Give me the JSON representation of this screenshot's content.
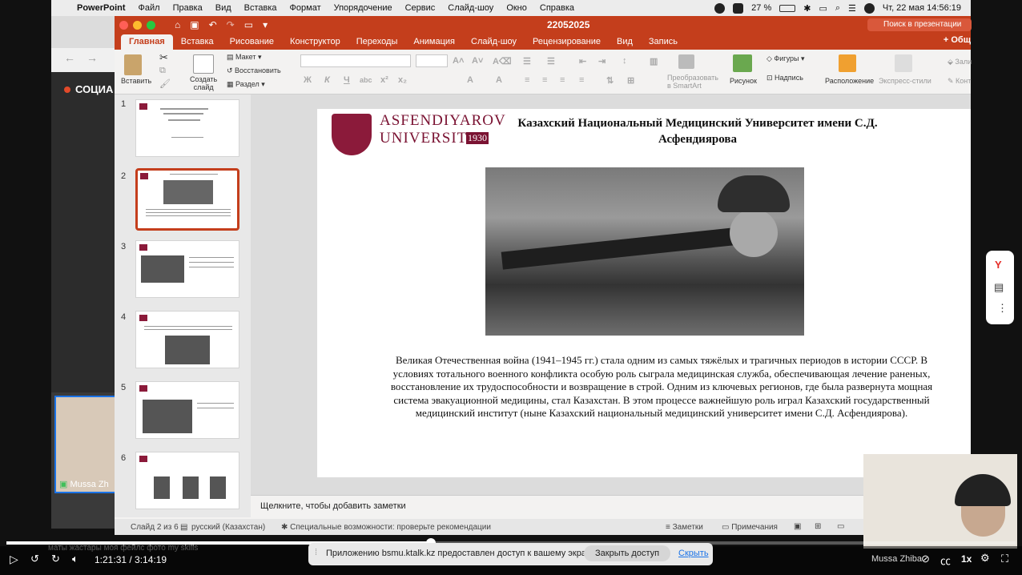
{
  "menubar": {
    "app": "PowerPoint",
    "items": [
      "Файл",
      "Правка",
      "Вид",
      "Вставка",
      "Формат",
      "Упорядочение",
      "Сервис",
      "Слайд-шоу",
      "Окно",
      "Справка"
    ],
    "battery": "27 %",
    "datetime": "Чт, 22 мая  14:56:19"
  },
  "background": {
    "social_label": "СОЦИА",
    "self_cam_name": "Mussa Zh"
  },
  "ppt": {
    "doc_title": "22052025",
    "search_placeholder": "Поиск в презентации",
    "share_label": "Общ",
    "tabs": [
      "Главная",
      "Вставка",
      "Рисование",
      "Конструктор",
      "Переходы",
      "Анимация",
      "Слайд-шоу",
      "Рецензирование",
      "Вид",
      "Запись"
    ],
    "ribbon": {
      "paste": "Вставить",
      "new_slide": "Создать\nслайд",
      "layout": "Макет",
      "reset": "Восстановить",
      "section": "Раздел",
      "convert_smartart": "Преобразовать\nв SmartArt",
      "picture": "Рисунок",
      "shapes": "Фигуры",
      "textbox": "Надпись",
      "arrange": "Расположение",
      "quick_styles": "Экспресс-стили",
      "fill_short": "Зали",
      "outline_short": "Конт"
    },
    "slides": [
      1,
      2,
      3,
      4,
      5,
      6
    ],
    "selected_slide": 2,
    "slide": {
      "logo_line1": "ASFENDIYAROV",
      "logo_line2": "UNIVERSITY",
      "logo_year": "1930",
      "title": "Казахский Национальный Медицинский Университет имени С.Д. Асфендиярова",
      "body": "Великая Отечественная война (1941–1945 гг.) стала одним из самых тяжёлых и трагичных периодов в истории СССР. В условиях тотального военного конфликта особую роль сыграла медицинская служба, обеспечивающая лечение раненых, восстановление их трудоспособности и возвращение в строй. Одним из ключевых регионов, где была развернута мощная система эвакуационной медицины, стал Казахстан. В этом процессе важнейшую роль играл Казахский государственный медицинский институт (ныне Казахский национальный медицинский университет имени С.Д. Асфендиярова)."
    },
    "notes_placeholder": "Щелкните, чтобы добавить заметки",
    "status": {
      "slide_of": "Слайд 2 из 6",
      "language": "русский (Казахстан)",
      "accessibility": "Специальные возможности: проверьте рекомендации",
      "notes": "Заметки",
      "comments": "Примечания"
    }
  },
  "player": {
    "time": "1:21:31 / 3:14:19",
    "progress_fraction": 0.42,
    "share_notice": "Приложению bsmu.ktalk.kz предоставлен доступ к вашему экрану.",
    "stop_share": "Закрыть доступ",
    "hide": "Скрыть",
    "speed": "1x",
    "webcam_name": "Mussa Zhiba",
    "task_text": "маты жастары   моя        фейлс      фото        my skills"
  }
}
